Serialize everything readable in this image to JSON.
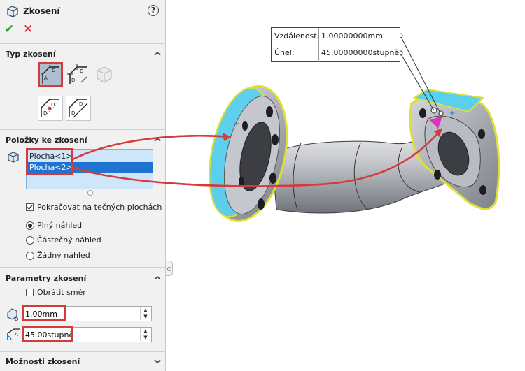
{
  "header": {
    "title": "Zkosení",
    "help": "?",
    "ok": "✔",
    "cancel": "✕"
  },
  "sections": {
    "type": {
      "title": "Typ zkosení"
    },
    "items": {
      "title": "Položky ke zkosení",
      "list": [
        "Plocha<1>",
        "Plocha<2>"
      ],
      "tangent_label": "Pokračovat na tečných plochách",
      "tangent_checked": true,
      "preview_options": [
        "Plný náhled",
        "Částečný náhled",
        "Žádný náhled"
      ],
      "preview_selected": "Plný náhled"
    },
    "params": {
      "title": "Parametry zkosení",
      "reverse_label": "Obrátit směr",
      "distance_value": "1.00mm",
      "angle_value": "45.00stupně"
    },
    "options": {
      "title": "Možnosti zkosení"
    }
  },
  "callout": {
    "distance_label": "Vzdálenost:",
    "distance_value": "1.00000000mm",
    "angle_label": "Úhel:",
    "angle_value": "45.00000000stupně"
  },
  "colors": {
    "accent_red": "#d23c3c",
    "selection_blue": "#1e74d0",
    "highlight_yellow": "#f2f20a",
    "face_cyan": "#5ad0f0"
  }
}
